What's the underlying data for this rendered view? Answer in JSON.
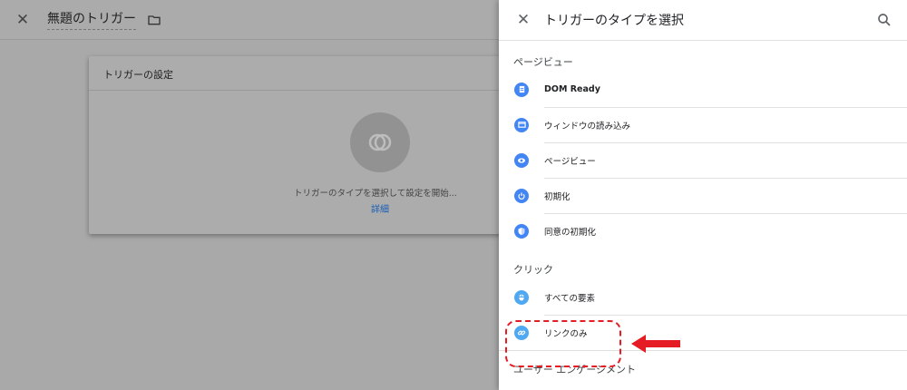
{
  "editor": {
    "title": "無題のトリガー",
    "card": {
      "title": "トリガーの設定",
      "hint": "トリガーのタイプを選択して設定を開始...",
      "link": "詳細"
    }
  },
  "panel": {
    "title": "トリガーのタイプを選択",
    "sections": [
      {
        "label": "ページビュー",
        "items": [
          {
            "label": "DOM Ready",
            "icon": "document-icon",
            "color": "#4285f4"
          },
          {
            "label": "ウィンドウの読み込み",
            "icon": "window-icon",
            "color": "#4285f4"
          },
          {
            "label": "ページビュー",
            "icon": "eye-icon",
            "color": "#4285f4"
          },
          {
            "label": "初期化",
            "icon": "power-icon",
            "color": "#4285f4"
          },
          {
            "label": "同意の初期化",
            "icon": "shield-icon",
            "color": "#4285f4"
          }
        ]
      },
      {
        "label": "クリック",
        "items": [
          {
            "label": "すべての要素",
            "icon": "mouse-icon",
            "color": "#4fa9f2"
          },
          {
            "label": "リンクのみ",
            "icon": "link-icon",
            "color": "#4fa9f2"
          }
        ]
      },
      {
        "label": "ユーザー エンゲージメント",
        "items": []
      }
    ]
  },
  "annotation": {
    "color": "#e51c23"
  }
}
